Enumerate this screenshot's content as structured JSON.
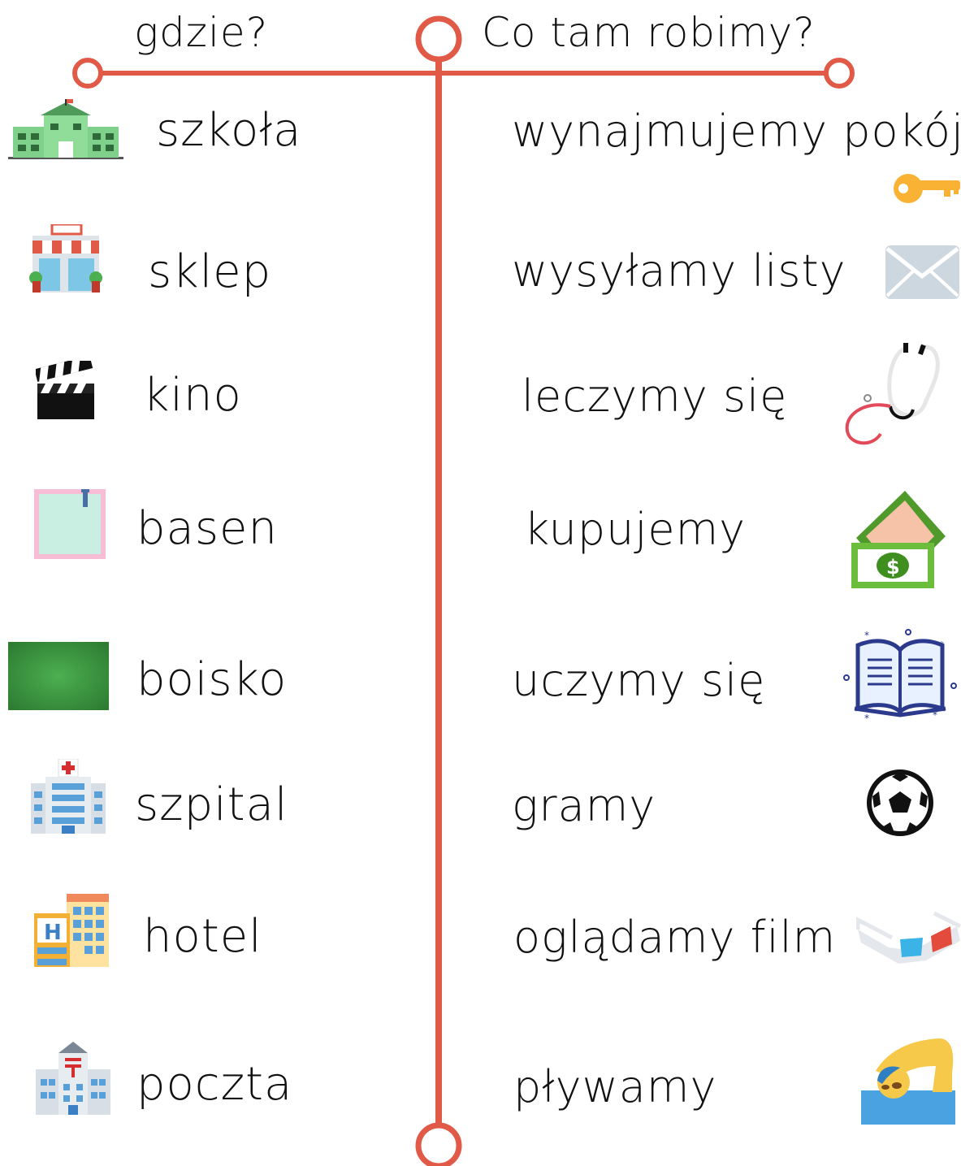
{
  "header": {
    "left_title": "gdzie?",
    "right_title": "Co tam robimy?"
  },
  "accent_color": "#e05a47",
  "places": [
    {
      "label": "szkoła",
      "icon": "school-icon"
    },
    {
      "label": "sklep",
      "icon": "shop-icon"
    },
    {
      "label": "kino",
      "icon": "clapperboard-icon"
    },
    {
      "label": "basen",
      "icon": "pool-icon"
    },
    {
      "label": "boisko",
      "icon": "grass-field-icon"
    },
    {
      "label": "szpital",
      "icon": "hospital-icon"
    },
    {
      "label": "hotel",
      "icon": "hotel-icon"
    },
    {
      "label": "poczta",
      "icon": "post-office-icon"
    }
  ],
  "activities": [
    {
      "label": "wynajmujemy pokój",
      "icon": "key-icon"
    },
    {
      "label": "wysyłamy listy",
      "icon": "envelope-icon"
    },
    {
      "label": "leczymy się",
      "icon": "stethoscope-icon"
    },
    {
      "label": "kupujemy",
      "icon": "money-icon"
    },
    {
      "label": "uczymy się",
      "icon": "open-book-icon"
    },
    {
      "label": "gramy",
      "icon": "soccer-ball-icon"
    },
    {
      "label": "oglądamy film",
      "icon": "3d-glasses-icon"
    },
    {
      "label": "pływamy",
      "icon": "swimmer-icon"
    }
  ]
}
